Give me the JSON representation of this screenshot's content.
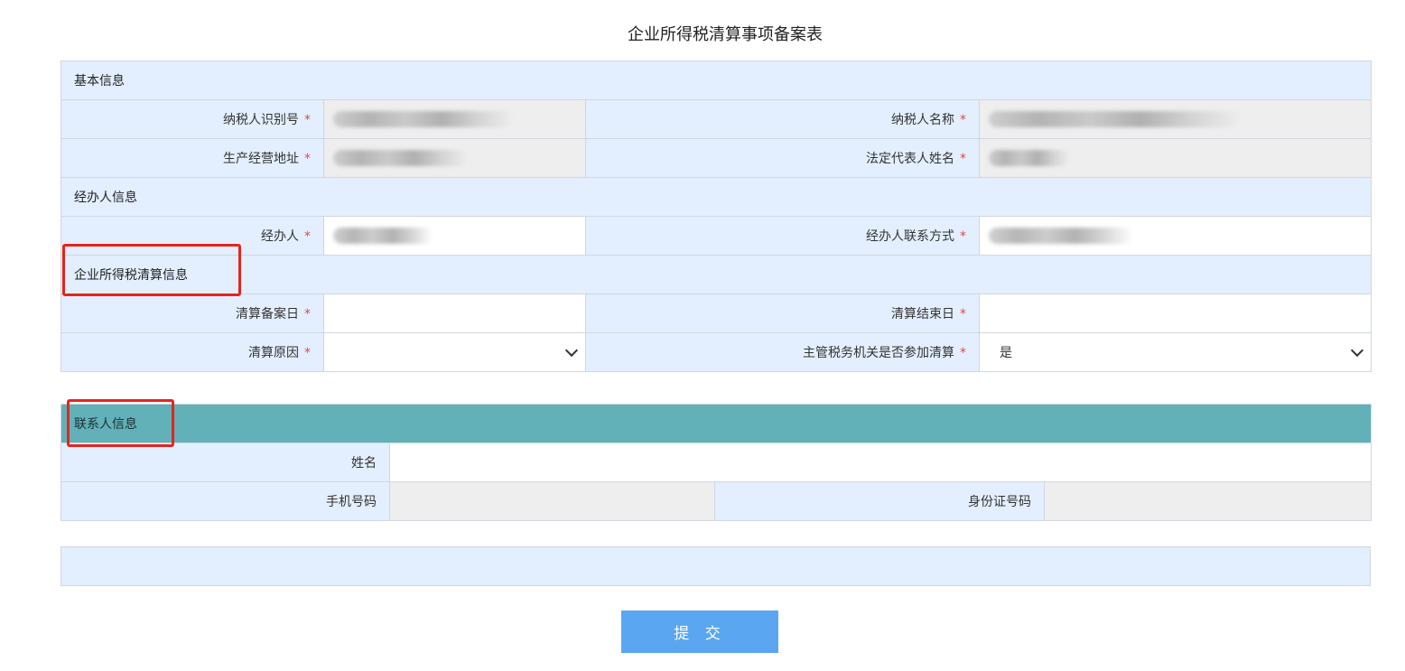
{
  "title": "企业所得税清算事项备案表",
  "required_mark": "*",
  "sections": {
    "basic_info": "基本信息",
    "agent_info": "经办人信息",
    "liquidation_info": "企业所得税清算信息",
    "contact_info": "联系人信息"
  },
  "fields": {
    "taxpayer_id": "纳税人识别号",
    "taxpayer_name": "纳税人名称",
    "address": "生产经营地址",
    "legal_rep": "法定代表人姓名",
    "agent": "经办人",
    "agent_contact": "经办人联系方式",
    "filing_date": "清算备案日",
    "end_date": "清算结束日",
    "reason": "清算原因",
    "tax_authority_join": "主管税务机关是否参加清算"
  },
  "selects": {
    "reason_value": "",
    "tax_authority_join_value": "是"
  },
  "contact_fields": {
    "name": "姓名",
    "phone": "手机号码",
    "id_number": "身份证号码"
  },
  "submit_label": "提 交",
  "colors": {
    "section_bg": "#e3efff",
    "readonly_bg": "#eeeeee",
    "teal_header": "#62b1b9",
    "submit_bg": "#5aa6f1",
    "required": "#e64545",
    "highlight": "#e6241d"
  }
}
